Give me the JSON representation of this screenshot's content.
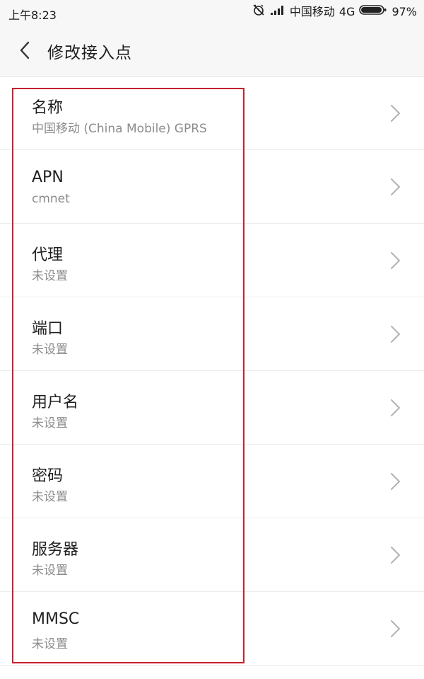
{
  "status_bar": {
    "time": "上午8:23",
    "carrier": "中国移动",
    "network": "4G",
    "battery": "97%",
    "battery_level": 0.97
  },
  "header": {
    "title": "修改接入点"
  },
  "items": [
    {
      "label": "名称",
      "value": "中国移动 (China Mobile) GPRS"
    },
    {
      "label": "APN",
      "value": "cmnet"
    },
    {
      "label": "代理",
      "value": "未设置"
    },
    {
      "label": "端口",
      "value": "未设置"
    },
    {
      "label": "用户名",
      "value": "未设置"
    },
    {
      "label": "密码",
      "value": "未设置"
    },
    {
      "label": "服务器",
      "value": "未设置"
    },
    {
      "label": "MMSC",
      "value": "未设置"
    }
  ],
  "colors": {
    "highlight": "#c8202f",
    "secondary_text": "#8c8c8c"
  }
}
